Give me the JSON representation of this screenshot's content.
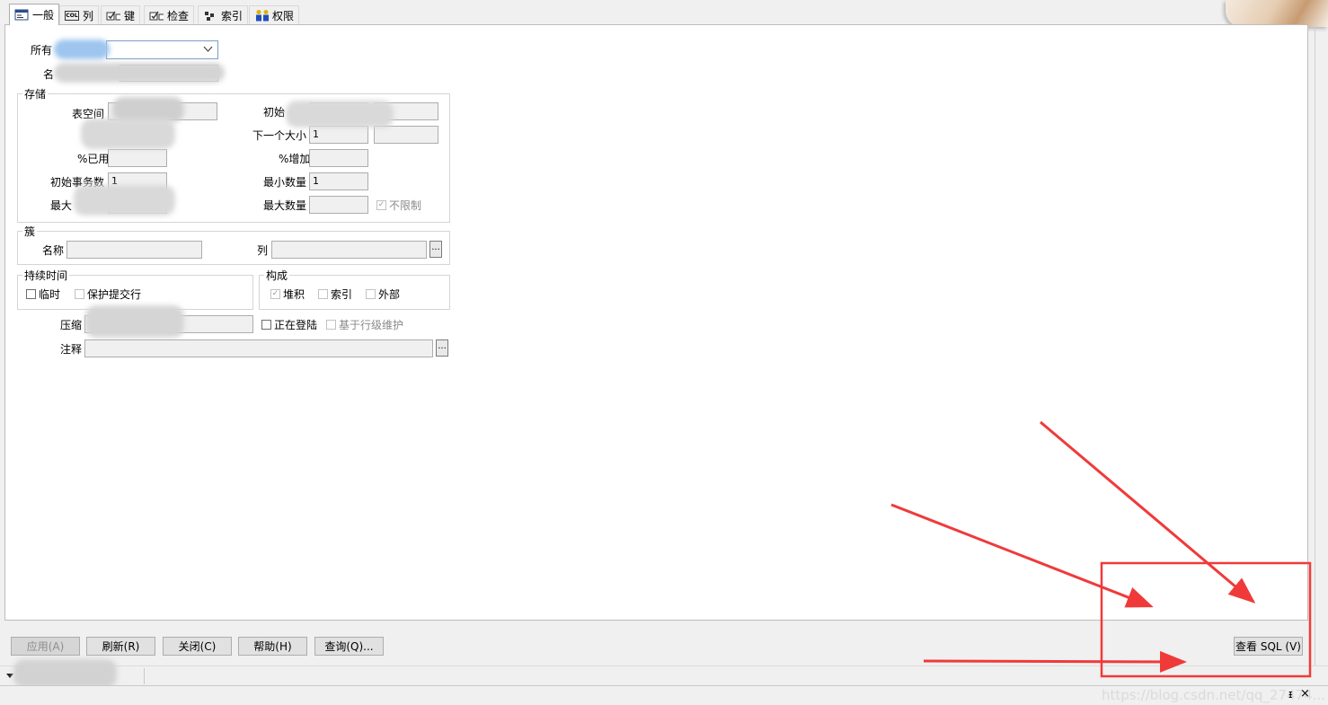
{
  "tabs": [
    {
      "label": "一般",
      "icon": "general-icon"
    },
    {
      "label": "列",
      "icon": "col-icon",
      "icon_text": "COL"
    },
    {
      "label": "键",
      "icon": "key-icon"
    },
    {
      "label": "检查",
      "icon": "check-icon"
    },
    {
      "label": "索引",
      "icon": "index-icon"
    },
    {
      "label": "权限",
      "icon": "users-icon"
    }
  ],
  "general": {
    "owner_label": "所有",
    "name_label": "名"
  },
  "storage": {
    "title": "存储",
    "tablespace_label": "表空间",
    "initial_label": "初始",
    "next_size_label": "下一个大小",
    "next_size_value": "1",
    "pct_used_label": "%已用",
    "pct_increase_label": "%增加",
    "initrans_label": "初始事务数",
    "initrans_value": "1",
    "min_extents_label": "最小数量",
    "min_extents_value": "1",
    "maxtrans_label": "最大",
    "max_extents_label": "最大数量",
    "unlimited_label": "不限制"
  },
  "cluster": {
    "title": "簇",
    "name_label": "名称",
    "columns_label": "列",
    "columns_button": "..."
  },
  "duration": {
    "title": "持续时间",
    "temporary_label": "临时",
    "preserve_rows_label": "保护提交行"
  },
  "organization": {
    "title": "构成",
    "heap_label": "堆积",
    "index_label": "索引",
    "external_label": "外部"
  },
  "compress": {
    "label": "压缩",
    "logging_label": "正在登陆",
    "row_maintenance_label": "基于行级维护"
  },
  "comment": {
    "label": "注释",
    "button": "..."
  },
  "buttons": {
    "apply": "应用(A)",
    "refresh": "刷新(R)",
    "close": "关闭(C)",
    "help": "帮助(H)",
    "query": "查询(Q)...",
    "view_sql": "查看 SQL (V)"
  },
  "bottombar": {
    "pin": "ᵻ",
    "close": "×",
    "watermark": "https://blog.csdn.net/qq_27474..."
  },
  "colors": {
    "annotation": "#f03a3a",
    "panel_bg": "#ffffff",
    "window_bg": "#f0f0f0"
  }
}
